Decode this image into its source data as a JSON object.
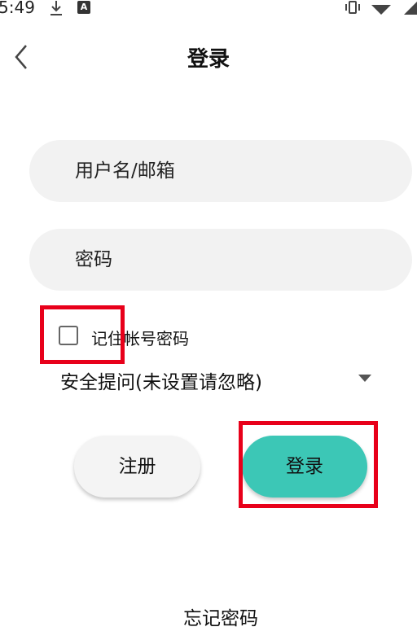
{
  "status_bar": {
    "time": "5:49",
    "download_icon": "download-icon",
    "app_notification_icon": "a-notification-icon",
    "right_icons": [
      "vibrate-icon",
      "wifi-icon",
      "cellular-icon"
    ]
  },
  "app_bar": {
    "title": "登录",
    "back_icon": "chevron-left-icon"
  },
  "form": {
    "username_placeholder": "用户名/邮箱",
    "username_value": "",
    "password_placeholder": "密码",
    "password_value": "",
    "remember_label": "记住帐号密码",
    "remember_checked": false,
    "security_question": "安全提问(未设置请忽略)"
  },
  "buttons": {
    "register_label": "注册",
    "login_label": "登录"
  },
  "forgot_password": "忘记密码",
  "colors": {
    "login_button": "#3cc7b6",
    "field_background": "#f2f2f2",
    "highlight_box": "#e8001a"
  }
}
